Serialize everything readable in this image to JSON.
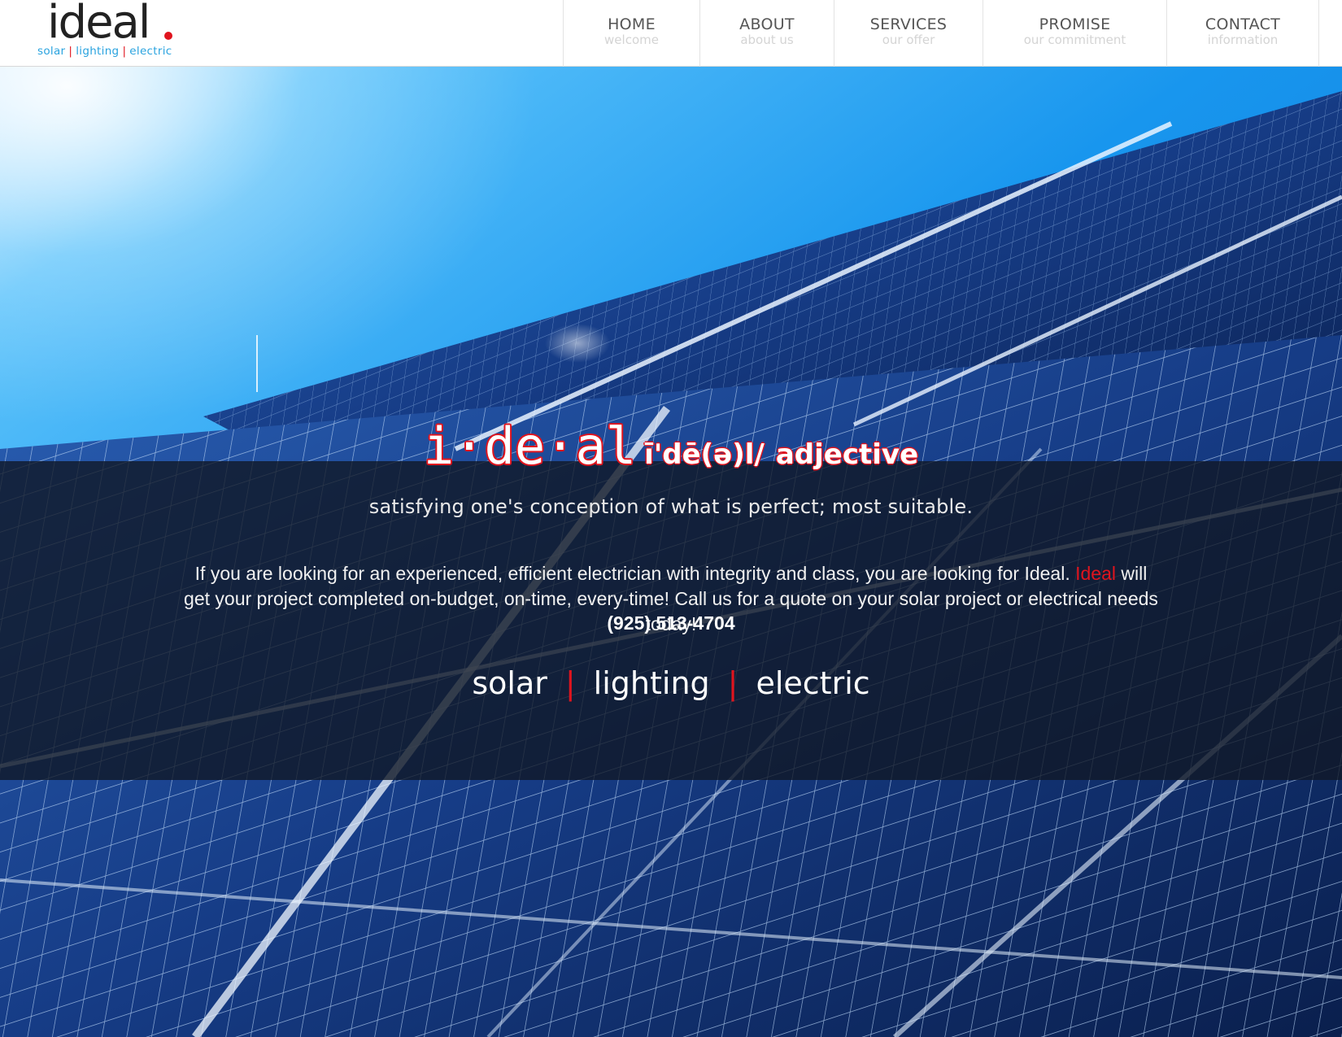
{
  "header": {
    "logo": {
      "word": "ideal",
      "tagline": [
        "solar",
        "lighting",
        "electric"
      ],
      "tagline_separator": "|"
    },
    "nav": [
      {
        "label": "HOME",
        "sub": "welcome"
      },
      {
        "label": "ABOUT",
        "sub": "about us"
      },
      {
        "label": "SERVICES",
        "sub": "our offer"
      },
      {
        "label": "PROMISE",
        "sub": "our commitment"
      },
      {
        "label": "CONTACT",
        "sub": "information"
      }
    ]
  },
  "hero": {
    "title_word": "i·de·al",
    "title_phonetic": "ī'dē(ə)l/",
    "title_part_of_speech": "adjective",
    "definition": "satisfying one's conception of what is perfect; most suitable.",
    "body_before": "If you are looking for an experienced, efficient electrician with integrity and class, you are looking for Ideal.",
    "body_brand": "Ideal",
    "body_after": "will get your project completed on-budget, on-time, every-time! Call us for a quote on your solar project or electrical needs today!",
    "phone": "(925) 513-4704",
    "tagline": [
      "solar",
      "lighting",
      "electric"
    ],
    "tagline_separator": "|"
  },
  "colors": {
    "accent_red": "#e0141e",
    "logo_blue": "#2aa3df",
    "sky_top": "#1f9ff2",
    "panel_dark": "#0b2558"
  }
}
